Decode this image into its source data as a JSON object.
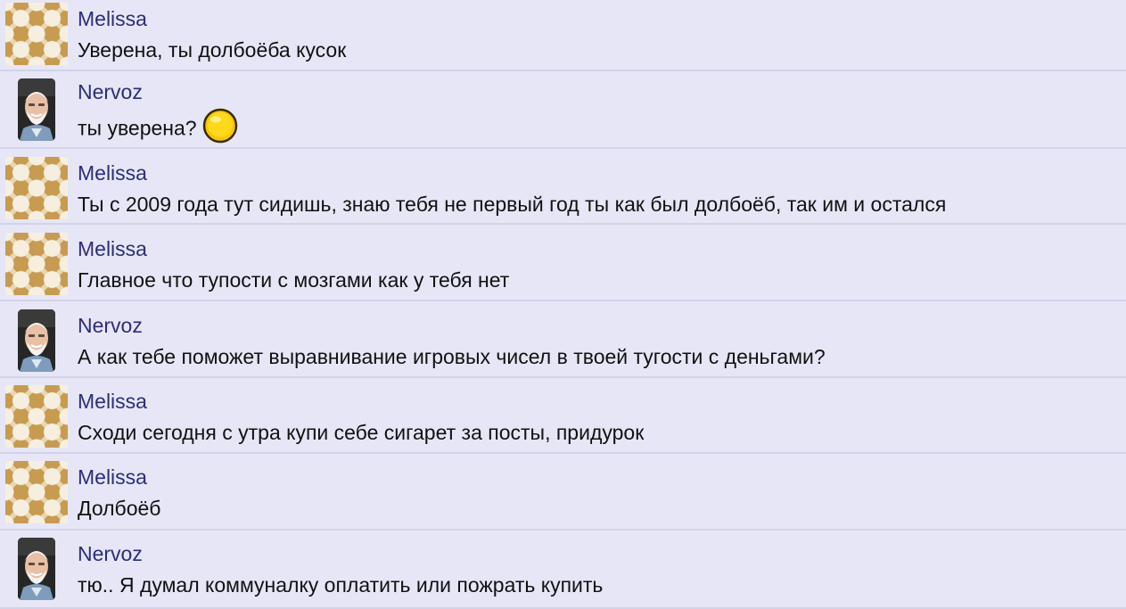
{
  "messages": [
    {
      "author": "Melissa",
      "text": "Уверена, ты долбоёба кусок",
      "avatar": "pattern-avatar"
    },
    {
      "author": "Nervoz",
      "text": "ты уверена?",
      "avatar": "photo-avatar",
      "emoji": "smiley-icon"
    },
    {
      "author": "Melissa",
      "text": "Ты с 2009 года тут сидишь, знаю тебя не первый год ты как был долбоёб, так им и остался",
      "avatar": "pattern-avatar"
    },
    {
      "author": "Melissa",
      "text": "Главное что тупости с мозгами как у тебя нет",
      "avatar": "pattern-avatar"
    },
    {
      "author": "Nervoz",
      "text": "А как тебе поможет выравнивание игровых чисел в твоей тугости с деньгами?",
      "avatar": "photo-avatar"
    },
    {
      "author": "Melissa",
      "text": "Сходи сегодня с утра купи себе сигарет за посты, придурок",
      "avatar": "pattern-avatar"
    },
    {
      "author": "Melissa",
      "text": "Долбоёб",
      "avatar": "pattern-avatar"
    },
    {
      "author": "Nervoz",
      "text": "тю.. Я думал коммуналку оплатить или пожрать купить",
      "avatar": "photo-avatar"
    }
  ],
  "colors": {
    "background": "#e6e6f7",
    "author_name": "#2b2e78",
    "message_text": "#111111",
    "divider": "#d2d2ea"
  }
}
